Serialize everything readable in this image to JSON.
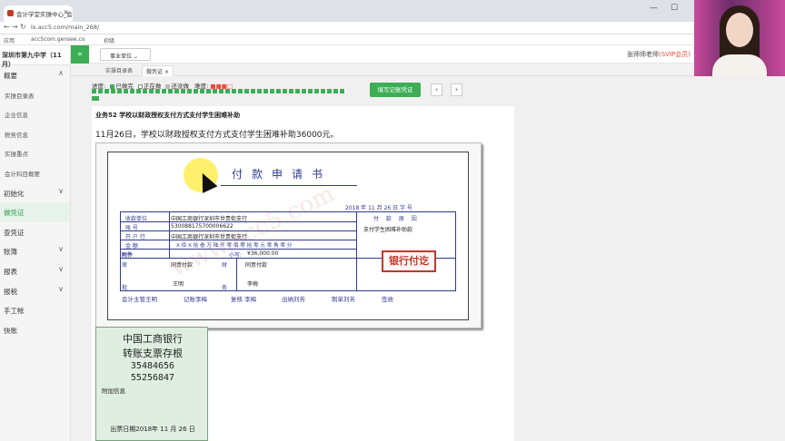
{
  "browser": {
    "tab_title": "会计学堂实操中心_会计...",
    "url": "lx.acc5.com/main_268/",
    "url_prefix": "acc5com.gensee.co",
    "bookmarks": [
      "应用",
      "初级"
    ]
  },
  "sidebar": {
    "school": "深圳市第九中学（11月）",
    "items": [
      {
        "label": "概要",
        "chevron": "∧"
      },
      {
        "label": "实操目录表",
        "sub": true
      },
      {
        "label": "企业信息",
        "sub": true
      },
      {
        "label": "税务信息",
        "sub": true
      },
      {
        "label": "实操重点",
        "sub": true
      },
      {
        "label": "会计科目概要",
        "sub": true
      },
      {
        "label": "初始化",
        "chevron": "∨"
      },
      {
        "label": "做凭证",
        "active": true
      },
      {
        "label": "查凭证"
      },
      {
        "label": "账簿",
        "chevron": "∨"
      },
      {
        "label": "报表",
        "chevron": "∨"
      },
      {
        "label": "报税",
        "chevron": "∨"
      },
      {
        "label": "手工帐"
      },
      {
        "label": "快账"
      }
    ]
  },
  "topnav": {
    "unit_select": "事业单位",
    "teacher": "张师师老师",
    "vip": "(SVIP会员)"
  },
  "subtabs": [
    "实操目录表",
    "做凭证"
  ],
  "progress": {
    "label": "进度:",
    "done": "已做完",
    "doing": "正在做",
    "todo": "还没做",
    "difficulty": "难度:",
    "fill_button": "填写记账凭证"
  },
  "business": {
    "title": "业务52 学校以财政授权支付方式支付学生困难补助",
    "desc": "11月26日，学校以财政授权支付方式支付学生困难补助36000元。"
  },
  "form": {
    "title": "付款申请书",
    "date": "2018 年 11 月 26 日    字    号",
    "payee_label": "收款单位",
    "payee": "中国工商银行深圳市世贵街支行",
    "account_label": "账      号",
    "account": "530088175700006622",
    "bank_label": "开 户 行",
    "bank": "中国工商银行深圳市世贵街支行",
    "amount_label": "金      额",
    "amount_words": "X 佰 X 拾 叁 万 陆 仟 零 佰 零 拾 零 元 零 角 零 分",
    "attach_label": "附件",
    "small_label": "小写:",
    "small_value": "¥36,000.00",
    "reason_label": "付 款 原 因",
    "reason": "支付学生困难补助款",
    "approve_label": "审",
    "approve_opinion": "同意付款",
    "approve_name": "王明",
    "batch_label": "批",
    "fin_label": "财",
    "fin_opinion": "同意付款",
    "fin_name": "李梅",
    "dept_label": "务",
    "stamp": "银行付讫",
    "sig": [
      "会计主管王明",
      "记账李梅",
      "复核 李梅",
      "出纳刘芳",
      "制单刘芳",
      "签收"
    ]
  },
  "cheque": {
    "bank": "中国工商银行",
    "title": "转账支票存根",
    "num1": "35484656",
    "num2": "55256847",
    "extra": "附加信息",
    "date": "出票日期2018年 11 月 26 日"
  },
  "watermark": "www.acc5.com"
}
